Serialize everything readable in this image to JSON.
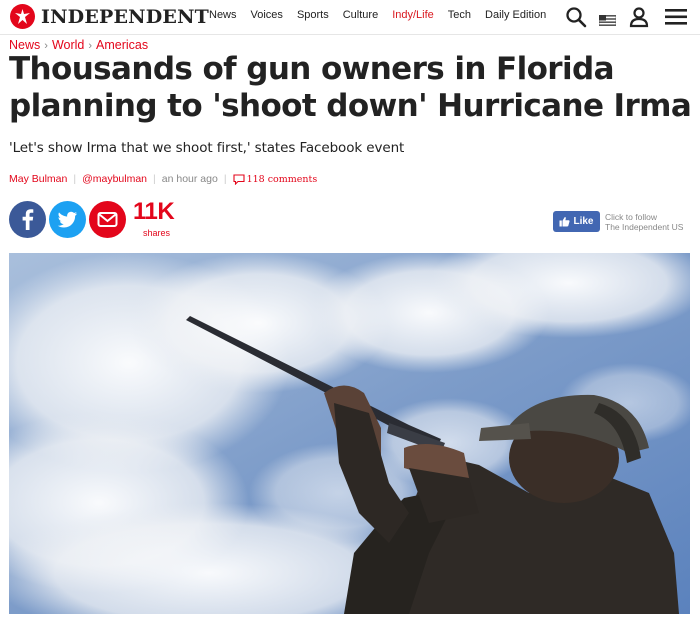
{
  "header": {
    "brand": "INDEPENDENT",
    "nav": [
      {
        "label": "News",
        "active": false
      },
      {
        "label": "Voices",
        "active": false
      },
      {
        "label": "Sports",
        "active": false
      },
      {
        "label": "Culture",
        "active": false
      },
      {
        "label": "Indy/Life",
        "active": true
      },
      {
        "label": "Tech",
        "active": false
      },
      {
        "label": "Daily Edition",
        "active": false
      }
    ],
    "icons": [
      "search-icon",
      "us-flag-icon",
      "account-icon",
      "menu-icon"
    ]
  },
  "breadcrumb": [
    "News",
    "World",
    "Americas"
  ],
  "article": {
    "headline_line1": "Thousands of gun owners in Florida",
    "headline_line2": "planning to 'shoot down' Hurricane Irma",
    "standfirst": "'Let's show Irma that we shoot first,' states Facebook event",
    "author": "May Bulman",
    "handle": "@maybulman",
    "time": "an hour ago",
    "comments": "118  comments"
  },
  "share": {
    "count": "11K",
    "label": "shares",
    "icons": [
      "facebook-icon",
      "twitter-icon",
      "email-icon"
    ]
  },
  "follow": {
    "like_label": "Like",
    "line1": "Click to follow",
    "line2": "The Independent US"
  },
  "colors": {
    "brand_red": "#e3061b",
    "facebook": "#3b5998",
    "twitter": "#1da1f2",
    "like_button": "#4267b2"
  }
}
